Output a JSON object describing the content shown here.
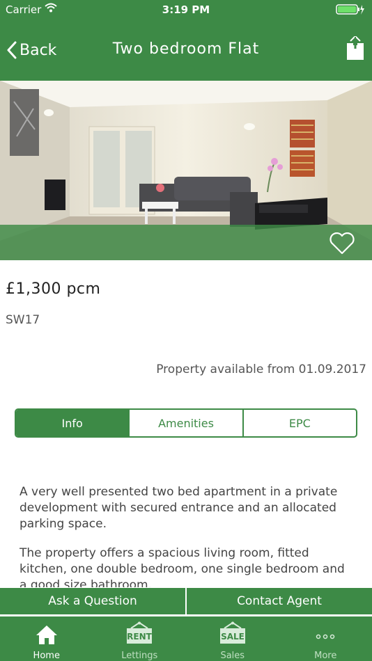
{
  "status_bar": {
    "carrier": "Carrier",
    "time": "3:19 PM"
  },
  "nav": {
    "back_label": "Back",
    "title": "Two bedroom Flat"
  },
  "listing": {
    "price": "£1,300 pcm",
    "postcode": "SW17",
    "availability": "Property available from 01.09.2017"
  },
  "tabs": [
    {
      "label": "Info",
      "active": true
    },
    {
      "label": "Amenities",
      "active": false
    },
    {
      "label": "EPC",
      "active": false
    }
  ],
  "description": [
    "A very well presented two bed apartment in a private development with secured entrance and an allocated parking space.",
    "The property offers a spacious living room, fitted kitchen, one double bedroom, one single bedroom and a good size bathroom."
  ],
  "actions": {
    "ask": "Ask a Question",
    "contact": "Contact Agent"
  },
  "tab_bar": [
    {
      "label": "Home",
      "icon": "home-icon",
      "active": true
    },
    {
      "label": "Lettings",
      "icon": "rent-sign-icon",
      "active": false,
      "badge": "RENT"
    },
    {
      "label": "Sales",
      "icon": "sale-sign-icon",
      "active": false,
      "badge": "SALE"
    },
    {
      "label": "More",
      "icon": "more-icon",
      "active": false
    }
  ],
  "colors": {
    "brand_green": "#3d8a46"
  }
}
